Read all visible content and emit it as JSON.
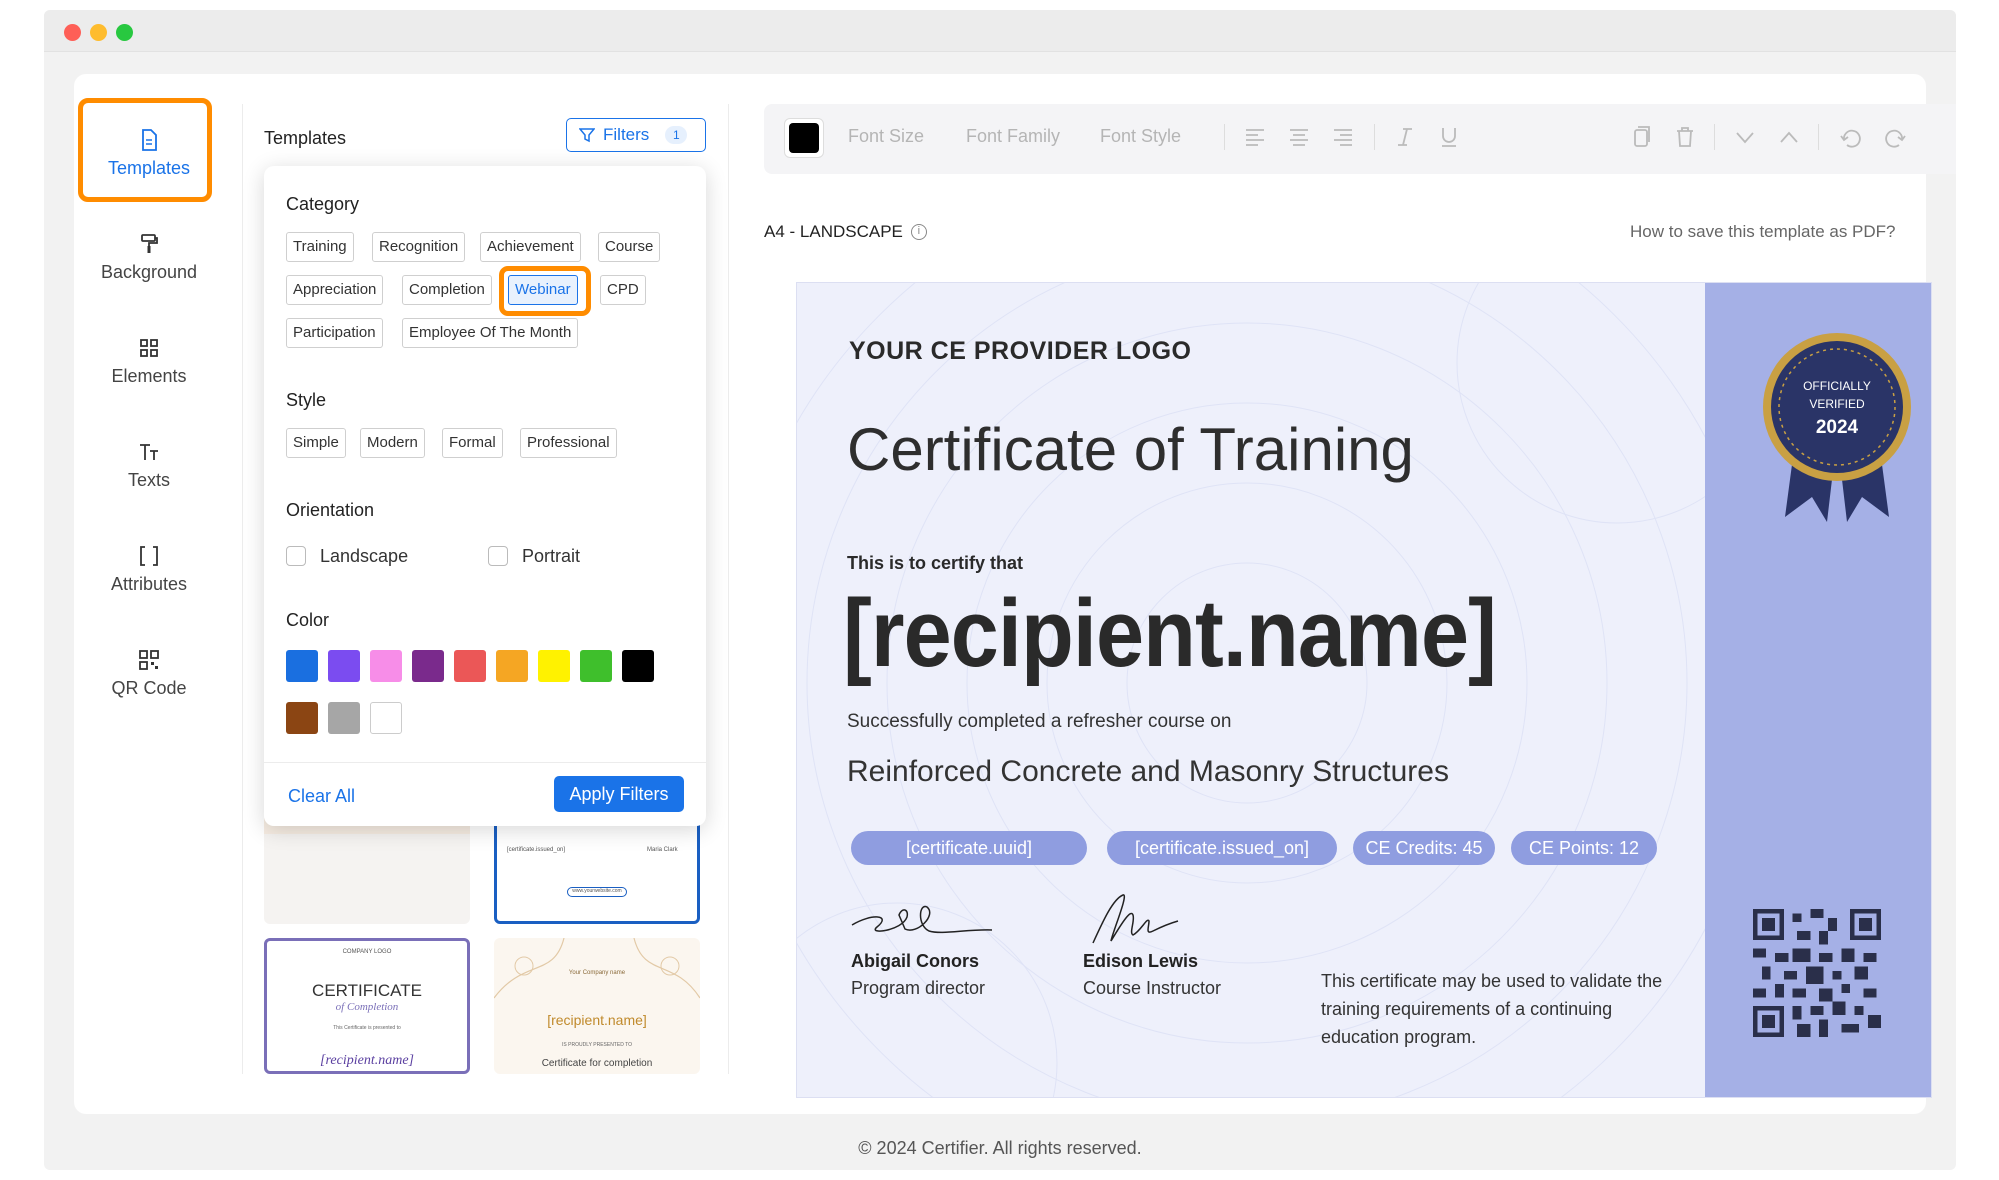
{
  "rail": {
    "items": [
      {
        "label": "Templates"
      },
      {
        "label": "Background"
      },
      {
        "label": "Elements"
      },
      {
        "label": "Texts"
      },
      {
        "label": "Attributes"
      },
      {
        "label": "QR Code"
      }
    ]
  },
  "templates_panel": {
    "title": "Templates",
    "filters_label": "Filters",
    "filters_count": "1"
  },
  "filter_dropdown": {
    "category": {
      "title": "Category",
      "options": [
        "Training",
        "Recognition",
        "Achievement",
        "Course",
        "Appreciation",
        "Completion",
        "Webinar",
        "CPD",
        "Participation",
        "Employee Of The Month"
      ],
      "selected": "Webinar"
    },
    "style": {
      "title": "Style",
      "options": [
        "Simple",
        "Modern",
        "Formal",
        "Professional"
      ]
    },
    "orientation": {
      "title": "Orientation",
      "options": [
        "Landscape",
        "Portrait"
      ]
    },
    "color": {
      "title": "Color",
      "swatches": [
        "#1a6fe0",
        "#7b4cf0",
        "#f78de8",
        "#7a2a8c",
        "#eb5757",
        "#f5a623",
        "#fff200",
        "#3fbf2c",
        "#000000",
        "#8b4513",
        "#a6a6a6",
        "#ffffff"
      ]
    },
    "clear_all": "Clear All",
    "apply": "Apply Filters"
  },
  "template_thumbs": {
    "thumb_left_text": {
      "logo": "COMPANY LOGO",
      "title": "CERTIFICATE",
      "subtitle": "of Completion",
      "intro": "This Certificate is presented to",
      "name": "[recipient.name]"
    },
    "thumb_right_text": {
      "company": "Your Company name",
      "name": "[recipient.name]",
      "presented": "IS PROUDLY PRESENTED TO",
      "title": "Certificate for completion"
    },
    "thumb_top_right_text": {
      "issued": "[certificate.issued_on]",
      "signer": "Maria Clark",
      "website": "www.yourwebsite.com"
    }
  },
  "toolbar": {
    "font_size": "Font Size",
    "font_family": "Font Family",
    "font_style": "Font Style",
    "text_color": "#000000"
  },
  "editor": {
    "size_label": "A4 - LANDSCAPE",
    "howto_link": "How to save this template as PDF?"
  },
  "certificate": {
    "logo": "YOUR CE PROVIDER LOGO",
    "title": "Certificate of Training",
    "certify": "This is to certify that",
    "recipient": "[recipient.name]",
    "completed": "Successfully completed a refresher course on",
    "course": "Reinforced Concrete and Masonry Structures",
    "pills": [
      "[certificate.uuid]",
      "[certificate.issued_on]",
      "CE Credits: 45",
      "CE Points: 12"
    ],
    "badge": {
      "line1": "OFFICIALLY",
      "line2": "VERIFIED",
      "year": "2024"
    },
    "signers": [
      {
        "name": "Abigail Conors",
        "role": "Program director"
      },
      {
        "name": "Edison Lewis",
        "role": "Course Instructor"
      }
    ],
    "note": "This certificate may be used to validate the training requirements of a continuing education program.",
    "side_color": "#a5b0e6",
    "background_color": "#eef0fb"
  },
  "footer": "© 2024 Certifier. All rights reserved.",
  "colors": {
    "accent": "#1a73e8",
    "highlight": "#ff8c00"
  }
}
